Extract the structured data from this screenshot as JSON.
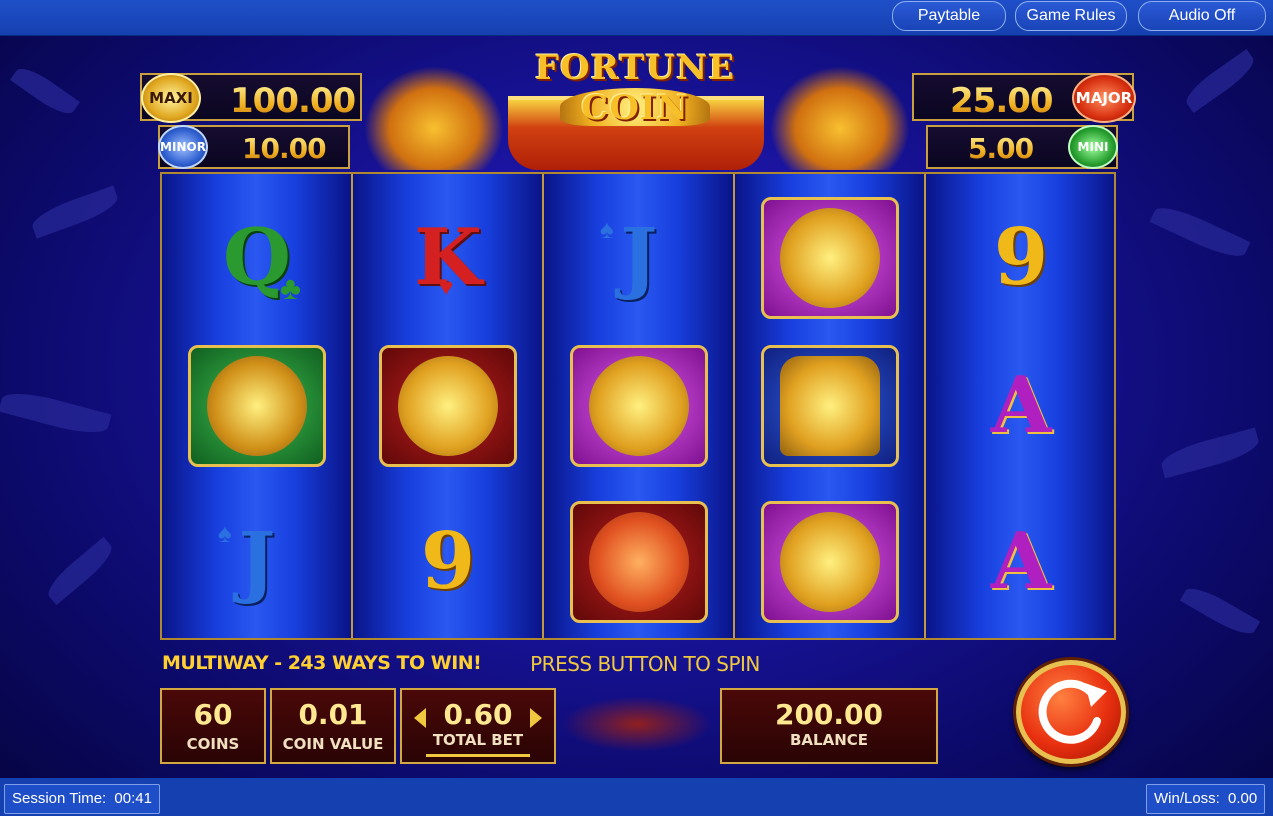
{
  "topbar": {
    "paytable_label": "Paytable",
    "game_rules_label": "Game Rules",
    "audio_label": "Audio Off"
  },
  "jackpots": {
    "maxi": {
      "badge": "MAXI",
      "value": "100.00"
    },
    "minor": {
      "badge": "MINOR",
      "value": "10.00"
    },
    "major": {
      "badge": "MAJOR",
      "value": "25.00"
    },
    "mini": {
      "badge": "MINI",
      "value": "5.00"
    }
  },
  "logo": "FORTUNE COIN",
  "reels": [
    [
      "Q-club",
      "turtle-dragon",
      "J-spade"
    ],
    [
      "K-heart",
      "foo-dog-gold",
      "9"
    ],
    [
      "J-spade",
      "koi-fish",
      "foo-dog-red"
    ],
    [
      "koi-fish",
      "bell-dragon",
      "koi-fish"
    ],
    [
      "9",
      "A-purple",
      "A-purple"
    ]
  ],
  "symbols": {
    "Q": "Q",
    "K": "K",
    "J": "J",
    "A": "A",
    "nine": "9"
  },
  "info": {
    "ways": "MULTIWAY - 243 WAYS TO WIN!",
    "prompt": "PRESS BUTTON TO SPIN"
  },
  "bet": {
    "coins_value": "60",
    "coins_label": "COINS",
    "coin_value": "0.01",
    "coin_value_label": "COIN VALUE",
    "total_bet": "0.60",
    "total_bet_label": "TOTAL BET",
    "balance": "200.00",
    "balance_label": "BALANCE"
  },
  "status": {
    "session_time_label": "Session Time:",
    "session_time": "00:41",
    "winloss_label": "Win/Loss:",
    "winloss": "0.00"
  },
  "colors": {
    "gold": "#d4a840",
    "topbar": "#1f4fc8",
    "reel_blue": "#1840e0",
    "card_green": "#2a9a30",
    "card_red": "#d42020",
    "card_blue": "#2a70e0",
    "card_gold": "#f0b818",
    "card_purple": "#b020c0"
  }
}
